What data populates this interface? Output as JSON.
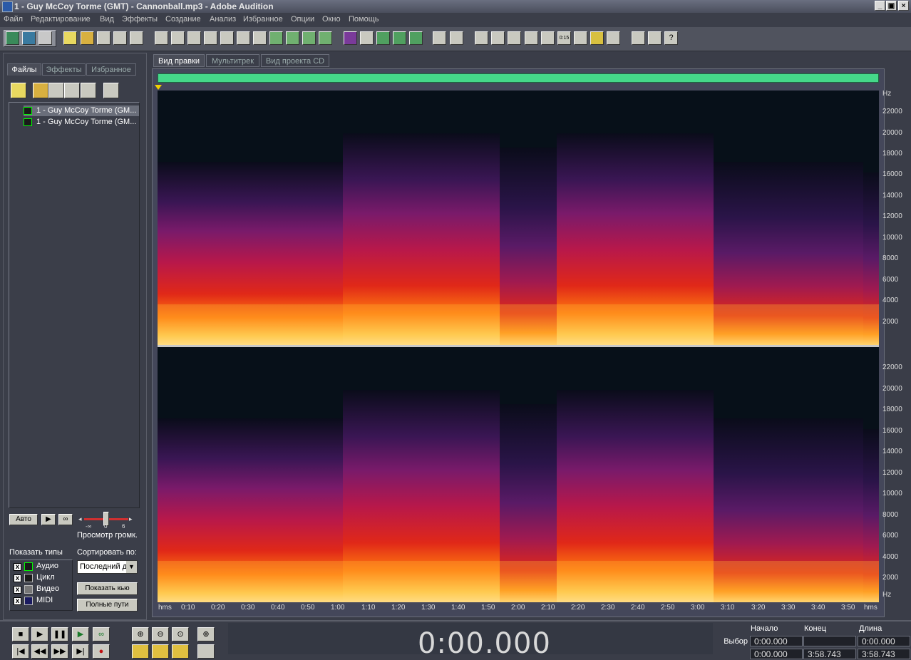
{
  "window": {
    "title": "1 - Guy McCoy Torme (GMT) - Cannonball.mp3 - Adobe Audition",
    "min": "_",
    "max": "▣",
    "close": "×"
  },
  "menu": [
    "Файл",
    "Редактирование",
    "Вид",
    "Эффекты",
    "Создание",
    "Анализ",
    "Избранное",
    "Опции",
    "Окно",
    "Помощь"
  ],
  "left_panel": {
    "tabs": [
      "Файлы",
      "Эффекты",
      "Избранное"
    ],
    "files": [
      "1 - Guy McCoy Torme (GM...",
      "1 - Guy McCoy Torme (GM..."
    ],
    "auto_button": "Авто",
    "volume_label": "Просмотр громк.",
    "volume_min": "-∞",
    "volume_zero": "0",
    "volume_max": "6",
    "show_types_label": "Показать типы",
    "types": [
      "Аудио",
      "Цикл",
      "Видео",
      "MIDI"
    ],
    "sort_label": "Сортировать по:",
    "sort_value": "Последний д",
    "show_cue_button": "Показать кью",
    "full_paths_button": "Полные пути"
  },
  "editor": {
    "tabs": [
      "Вид правки",
      "Мультитрек",
      "Вид проекта CD"
    ],
    "freq_unit": "Hz",
    "freq_ticks": [
      "22000",
      "20000",
      "18000",
      "16000",
      "14000",
      "12000",
      "10000",
      "8000",
      "6000",
      "4000",
      "2000"
    ],
    "time_unit": "hms",
    "time_ticks": [
      "0:10",
      "0:20",
      "0:30",
      "0:40",
      "0:50",
      "1:00",
      "1:10",
      "1:20",
      "1:30",
      "1:40",
      "1:50",
      "2:00",
      "2:10",
      "2:20",
      "2:30",
      "2:40",
      "2:50",
      "3:00",
      "3:10",
      "3:20",
      "3:30",
      "3:40",
      "3:50"
    ]
  },
  "transport": {
    "time_display": "0:00.000",
    "sel_headers": [
      "Начало",
      "Конец",
      "Длина"
    ],
    "sel_row_label": "Выбор",
    "sel_row": [
      "0:00.000",
      "",
      "0:00.000"
    ],
    "view_row": [
      "0:00.000",
      "3:58.743",
      "3:58.743"
    ]
  }
}
